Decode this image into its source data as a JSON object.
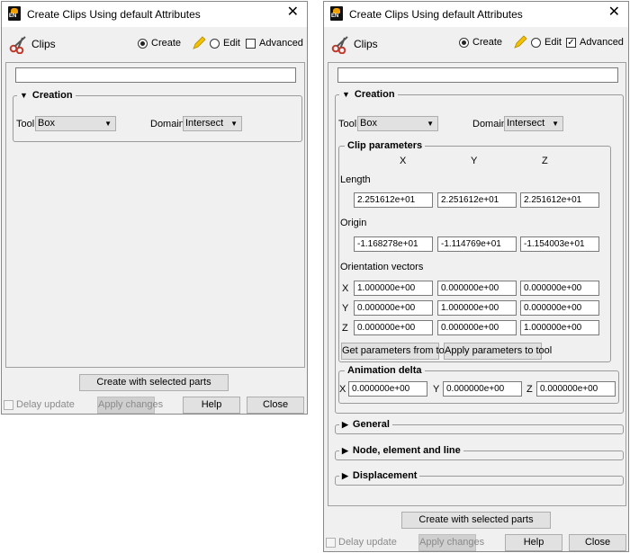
{
  "window_title": "Create Clips Using default Attributes",
  "close_glyph": "✕",
  "header": {
    "label": "Clips",
    "mode_create": "Create",
    "mode_edit": "Edit",
    "advanced": "Advanced"
  },
  "creation": {
    "title": "Creation",
    "tool_label": "Tool",
    "tool_value": "Box",
    "domain_label": "Domain",
    "domain_value": "Intersect"
  },
  "clip_params": {
    "title": "Clip parameters",
    "col_x": "X",
    "col_y": "Y",
    "col_z": "Z",
    "length_label": "Length",
    "length": [
      "2.251612e+01",
      "2.251612e+01",
      "2.251612e+01"
    ],
    "origin_label": "Origin",
    "origin": [
      "-1.168278e+01",
      "-1.114769e+01",
      "-1.154003e+01"
    ],
    "orient_label": "Orientation vectors",
    "orient_rows": [
      {
        "label": "X",
        "values": [
          "1.000000e+00",
          "0.000000e+00",
          "0.000000e+00"
        ]
      },
      {
        "label": "Y",
        "values": [
          "0.000000e+00",
          "1.000000e+00",
          "0.000000e+00"
        ]
      },
      {
        "label": "Z",
        "values": [
          "0.000000e+00",
          "0.000000e+00",
          "1.000000e+00"
        ]
      }
    ],
    "get_button": "Get parameters from tool",
    "apply_button": "Apply parameters to tool"
  },
  "animation": {
    "title": "Animation delta",
    "x_label": "X",
    "x_value": "0.000000e+00",
    "y_label": "Y",
    "y_value": "0.000000e+00",
    "z_label": "Z",
    "z_value": "0.000000e+00"
  },
  "sections": {
    "general": "General",
    "node": "Node, element and line",
    "displacement": "Displacement"
  },
  "footer": {
    "create_button": "Create with selected parts",
    "delay_update": "Delay update",
    "apply_changes": "Apply changes",
    "help": "Help",
    "close": "Close"
  },
  "left_window": {
    "advanced_checked": false
  },
  "right_window": {
    "advanced_checked": true
  }
}
